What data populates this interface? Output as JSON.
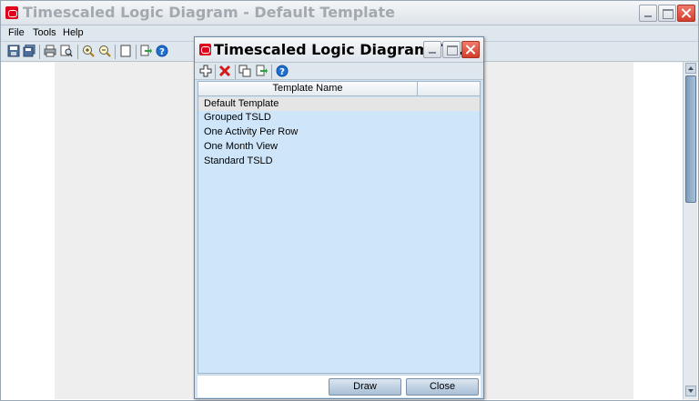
{
  "main_window": {
    "title": "Timescaled Logic Diagram - Default Template",
    "menu": [
      "File",
      "Tools",
      "Help"
    ],
    "toolbar_icons": [
      "save-icon",
      "save-all-icon",
      "print-icon",
      "print-preview-icon",
      "zoom-in-icon",
      "zoom-out-icon",
      "page-icon",
      "export-icon",
      "help-icon"
    ]
  },
  "dialog": {
    "title": "Timescaled Logic Diagram Te...",
    "toolbar_icons": [
      "add-icon",
      "delete-icon",
      "copy-icon",
      "modify-icon",
      "help-icon"
    ],
    "column_header": "Template Name",
    "templates": [
      "Default Template",
      "Grouped TSLD",
      "One Activity Per Row",
      "One Month View",
      "Standard TSLD"
    ],
    "selected_index": 0,
    "buttons": {
      "draw": "Draw",
      "close": "Close"
    }
  },
  "colors": {
    "dialog_bg": "#cfe3f5",
    "list_bg": "#cfe6fa",
    "oracle_red": "#e0001b"
  }
}
